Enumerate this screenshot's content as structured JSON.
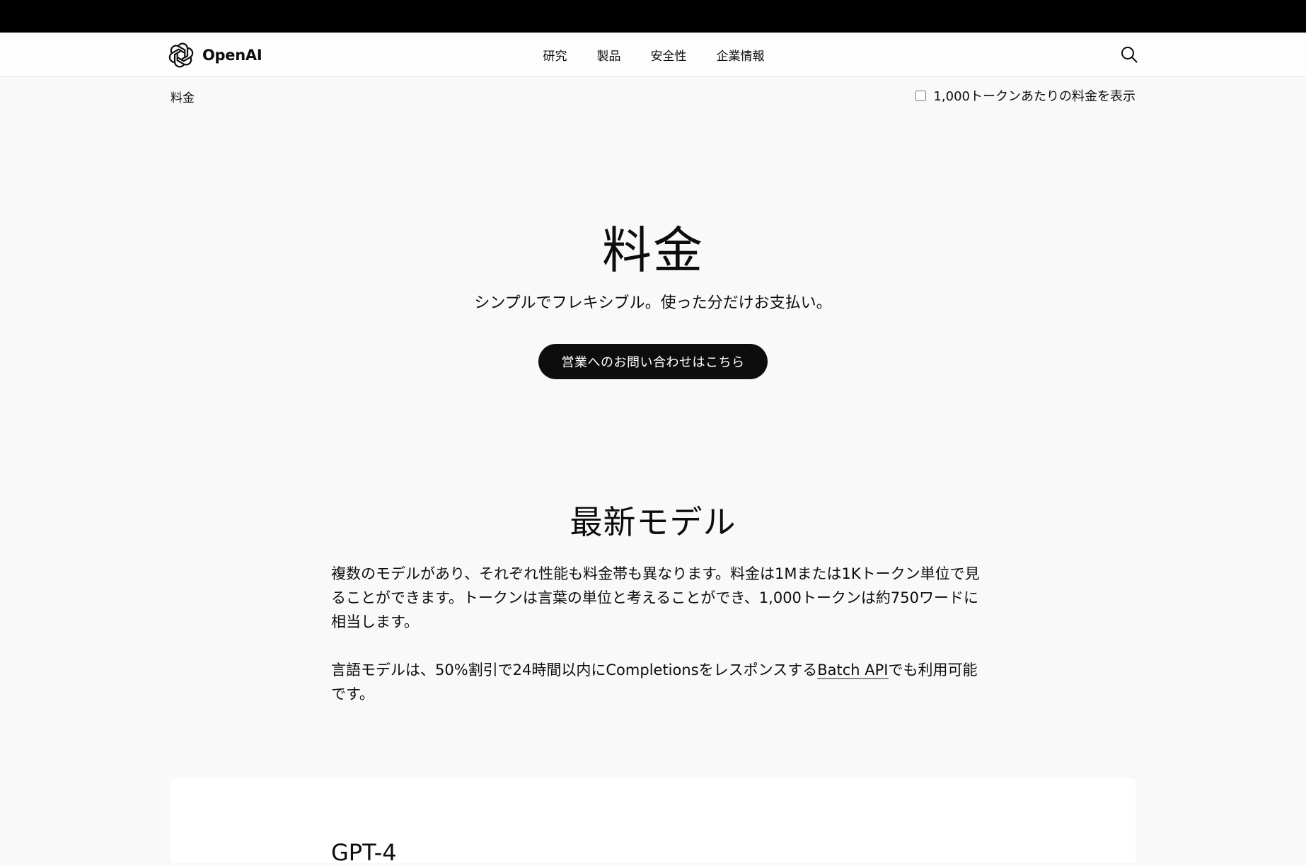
{
  "header": {
    "brand": "OpenAI",
    "nav": [
      {
        "label": "研究"
      },
      {
        "label": "製品"
      },
      {
        "label": "安全性"
      },
      {
        "label": "企業情報"
      }
    ]
  },
  "subbar": {
    "breadcrumb": "料金",
    "toggle_label": "1,000トークンあたりの料金を表示",
    "toggle_checked": false
  },
  "hero": {
    "title": "料金",
    "subtitle": "シンプルでフレキシブル。使った分だけお支払い。",
    "cta_label": "営業へのお問い合わせはこちら"
  },
  "section": {
    "title": "最新モデル",
    "paragraph1": "複数のモデルがあり、それぞれ性能も料金帯も異なります。料金は1Mまたは1Kトークン単位で見ることができます。トークンは言葉の単位と考えることができ、1,000トークンは約750ワードに相当します。",
    "paragraph2_before": "言語モデルは、50%割引で24時間以内にCompletionsをレスポンスする",
    "paragraph2_link": "Batch API",
    "paragraph2_after": "でも利用可能です。"
  },
  "card": {
    "title": "GPT-4"
  }
}
